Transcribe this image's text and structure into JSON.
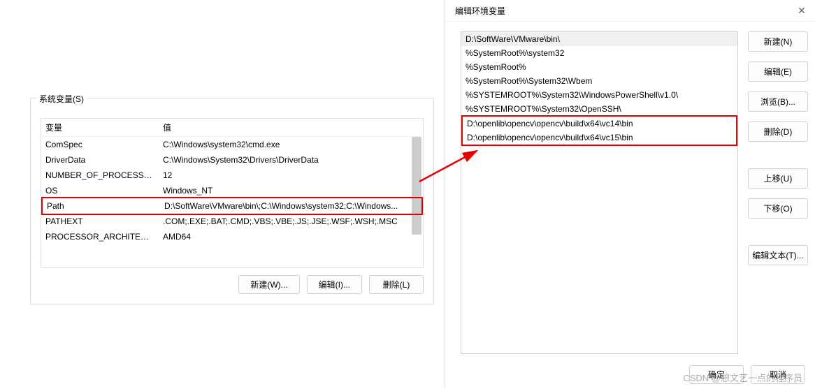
{
  "leftPanel": {
    "groupLabel": "系统变量(S)",
    "headers": {
      "variable": "变量",
      "value": "值"
    },
    "rows": [
      {
        "var": "ComSpec",
        "val": "C:\\Windows\\system32\\cmd.exe"
      },
      {
        "var": "DriverData",
        "val": "C:\\Windows\\System32\\Drivers\\DriverData"
      },
      {
        "var": "NUMBER_OF_PROCESSORS",
        "val": "12"
      },
      {
        "var": "OS",
        "val": "Windows_NT"
      },
      {
        "var": "Path",
        "val": "D:\\SoftWare\\VMware\\bin\\;C:\\Windows\\system32;C:\\Windows..."
      },
      {
        "var": "PATHEXT",
        "val": ".COM;.EXE;.BAT;.CMD;.VBS;.VBE;.JS;.JSE;.WSF;.WSH;.MSC"
      },
      {
        "var": "PROCESSOR_ARCHITECT...",
        "val": "AMD64"
      }
    ],
    "highlightedIndex": 4,
    "buttons": {
      "new": "新建(W)...",
      "edit": "编辑(I)...",
      "delete": "删除(L)"
    }
  },
  "rightDialog": {
    "title": "编辑环境变量",
    "paths": [
      "D:\\SoftWare\\VMware\\bin\\",
      "%SystemRoot%\\system32",
      "%SystemRoot%",
      "%SystemRoot%\\System32\\Wbem",
      "%SYSTEMROOT%\\System32\\WindowsPowerShell\\v1.0\\",
      "%SYSTEMROOT%\\System32\\OpenSSH\\",
      "D:\\openlib\\opencv\\opencv\\build\\x64\\vc14\\bin",
      "D:\\openlib\\opencv\\opencv\\build\\x64\\vc15\\bin"
    ],
    "selectedIndex": 0,
    "highlightStart": 6,
    "highlightEnd": 7,
    "buttons": {
      "new": "新建(N)",
      "edit": "编辑(E)",
      "browse": "浏览(B)...",
      "delete": "删除(D)",
      "moveUp": "上移(U)",
      "moveDown": "下移(O)",
      "editText": "编辑文本(T)..."
    },
    "footer": {
      "ok": "确定",
      "cancel": "取消"
    }
  },
  "watermark": "CSDN @想文艺一点的程序员"
}
